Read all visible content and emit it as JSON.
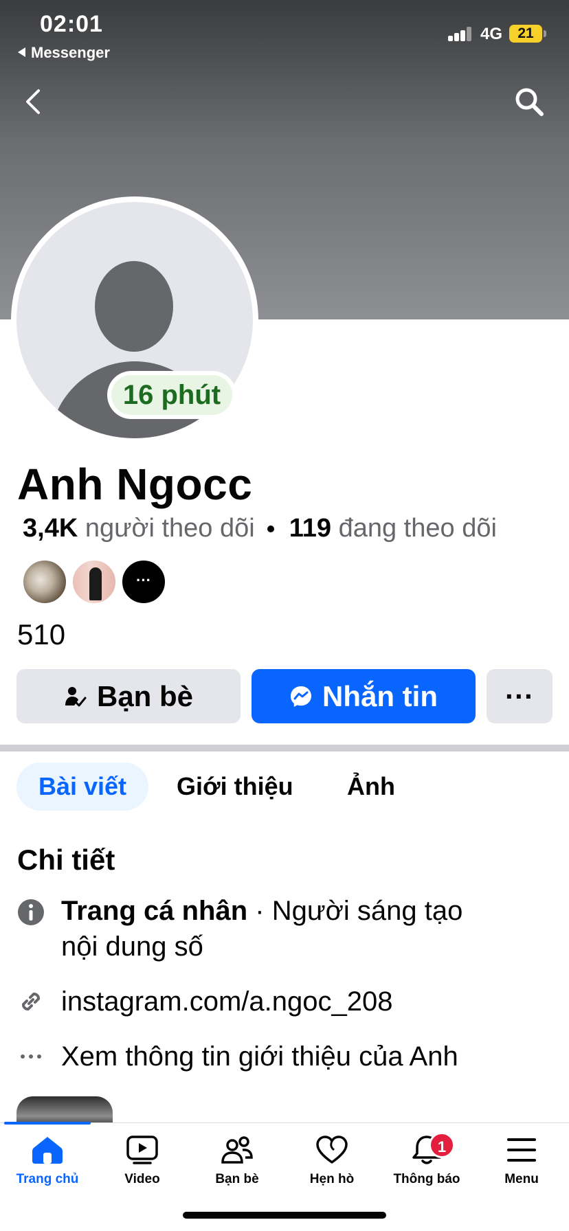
{
  "status_bar": {
    "time": "02:01",
    "back_app": "Messenger",
    "network": "4G",
    "battery": "21"
  },
  "profile": {
    "active_badge": "16 phút",
    "name": "Anh Ngocc",
    "followers_count": "3,4K",
    "followers_label": "người theo dõi",
    "following_count": "119",
    "following_label": "đang theo dõi",
    "followers_more": "···",
    "friend_count": "510"
  },
  "actions": {
    "friends_label": "Bạn bè",
    "message_label": "Nhắn tin",
    "more_label": "···"
  },
  "tabs": [
    {
      "label": "Bài viết",
      "active": true
    },
    {
      "label": "Giới thiệu",
      "active": false
    },
    {
      "label": "Ảnh",
      "active": false
    }
  ],
  "details": {
    "title": "Chi tiết",
    "profile_type_bold": "Trang cá nhân",
    "profile_type_rest": " · Người sáng tạo",
    "profile_type_line2": "nội dung số",
    "link": "instagram.com/a.ngoc_208",
    "see_more": "Xem thông tin giới thiệu của Anh"
  },
  "bottom_nav": [
    {
      "label": "Trang chủ",
      "icon": "home-icon",
      "active": true
    },
    {
      "label": "Video",
      "icon": "video-icon",
      "active": false
    },
    {
      "label": "Bạn bè",
      "icon": "friends-icon",
      "active": false
    },
    {
      "label": "Hẹn hò",
      "icon": "heart-icon",
      "active": false
    },
    {
      "label": "Thông báo",
      "icon": "bell-icon",
      "active": false,
      "badge": "1"
    },
    {
      "label": "Menu",
      "icon": "menu-icon",
      "active": false
    }
  ],
  "colors": {
    "accent": "#0866ff",
    "badge_green": "#1d6b20",
    "notification_red": "#e41e3f"
  }
}
